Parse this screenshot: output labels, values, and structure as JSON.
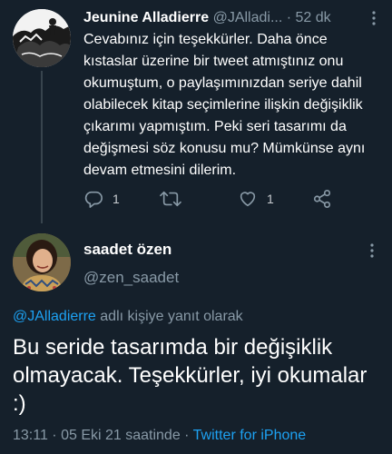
{
  "reply": {
    "display_name": "Jeunine Alladierre",
    "handle": "@JAlladi...",
    "separator": "·",
    "time": "52 dk",
    "text": "Cevabınız için teşekkürler. Daha önce kıstaslar üzerine bir tweet atmıştınız onu okumuştum, o paylaşımınızdan seriye dahil olabilecek kitap seçimlerine ilişkin değişiklik çıkarımı yapmıştım. Peki seri tasarımı da değişmesi söz konusu mu? Mümkünse aynı devam etmesini dilerim.",
    "actions": {
      "reply_icon": "reply-icon",
      "reply_count": "1",
      "retweet_icon": "retweet-icon",
      "like_icon": "like-icon",
      "like_count": "1",
      "share_icon": "share-icon"
    },
    "colors": {
      "avatar_bg": "#f3f3f3"
    }
  },
  "main": {
    "display_name": "saadet özen",
    "handle": "@zen_saadet",
    "replying_to_mention": "@JAlladierre",
    "replying_to_suffix": " adlı kişiye yanıt olarak",
    "text": "Bu seride tasarımda bir değişiklik olmayacak. Teşekkürler, iyi okumalar :)",
    "timestamp": "13:11 · 05 Eki 21 saatinde · ",
    "source": "Twitter for iPhone"
  },
  "colors": {
    "background": "#15202b",
    "secondary_text": "#8899a6",
    "link": "#1da1f2",
    "divider": "#38444d"
  }
}
